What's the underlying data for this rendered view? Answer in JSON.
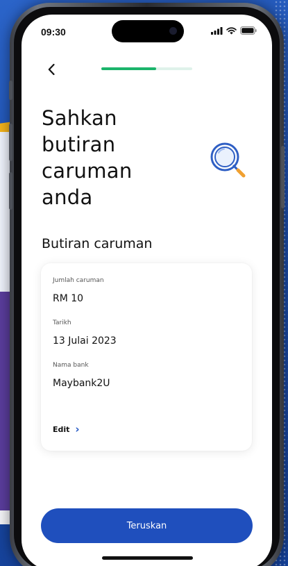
{
  "status_bar": {
    "time": "09:30"
  },
  "progress": {
    "fraction": 0.6
  },
  "page": {
    "title_lines": [
      "Sahkan",
      "butiran",
      "caruman",
      "anda"
    ],
    "section_heading": "Butiran caruman"
  },
  "details": {
    "amount_label": "Jumlah caruman",
    "amount_value": "RM 10",
    "date_label": "Tarikh",
    "date_value": "13 Julai 2023",
    "bank_label": "Nama bank",
    "bank_value": "Maybank2U",
    "edit_label": "Edit",
    "edit_chevron": "›"
  },
  "actions": {
    "continue_label": "Teruskan"
  },
  "icons": {
    "back": "chevron-left-icon",
    "magnifier": "magnifier-icon",
    "signal": "signal-icon",
    "wifi": "wifi-icon",
    "battery": "battery-icon"
  },
  "colors": {
    "primary": "#1f4fbd",
    "progress_fill": "#1bb46b",
    "progress_track": "#dff2ea",
    "magnifier": "#2f5fc4",
    "background_blue": "#1d4aa8"
  }
}
